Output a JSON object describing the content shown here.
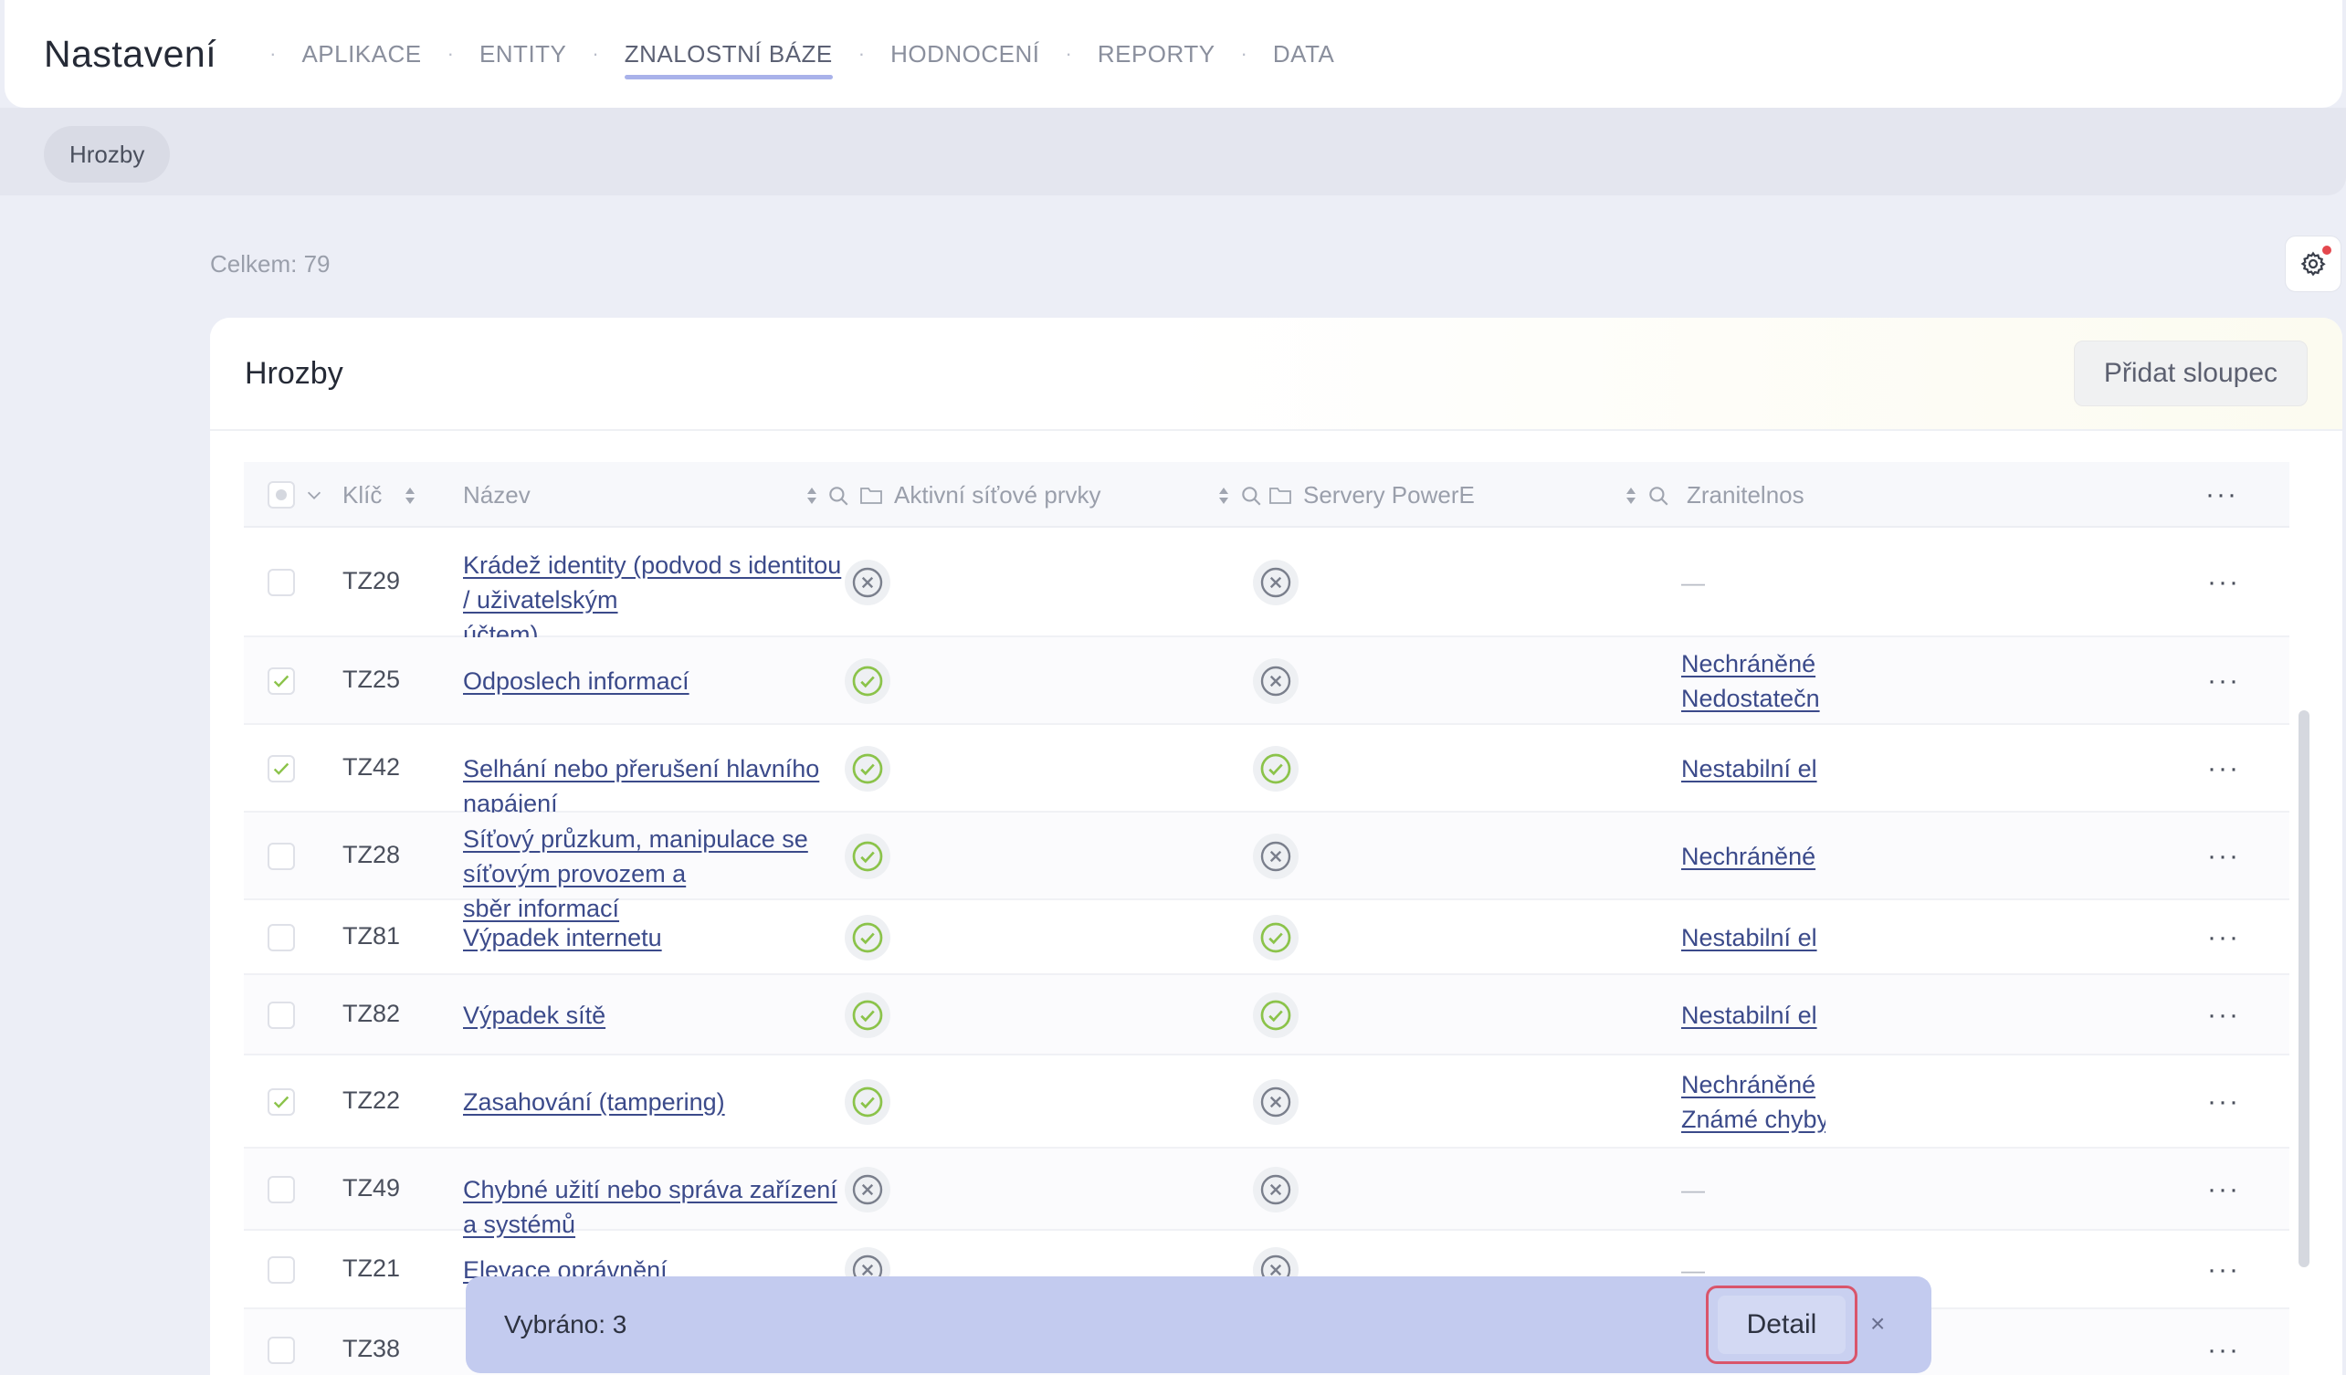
{
  "header": {
    "title": "Nastavení",
    "nav": [
      {
        "label": "APLIKACE",
        "active": false
      },
      {
        "label": "ENTITY",
        "active": false
      },
      {
        "label": "ZNALOSTNÍ BÁZE",
        "active": true
      },
      {
        "label": "HODNOCENÍ",
        "active": false
      },
      {
        "label": "REPORTY",
        "active": false
      },
      {
        "label": "DATA",
        "active": false
      }
    ]
  },
  "subnav": {
    "chip": "Hrozby"
  },
  "summary": {
    "total": "Celkem: 79"
  },
  "card": {
    "title": "Hrozby",
    "add_column_label": "Přidat sloupec"
  },
  "table": {
    "columns": {
      "key": "Klíč",
      "name": "Název",
      "col1": "Aktivní síťové prvky",
      "col2": "Servery PowerE",
      "col3": "Zranitelnos"
    },
    "rows": [
      {
        "checked": false,
        "key": "TZ29",
        "name": [
          "Krádež identity (podvod s identitou / uživatelským",
          "účtem)"
        ],
        "c1": "x",
        "c2": "x",
        "vuln": [
          "—"
        ]
      },
      {
        "checked": true,
        "key": "TZ25",
        "name": [
          "Odposlech informací"
        ],
        "c1": "ok",
        "c2": "x",
        "vuln": [
          "Nechráněné",
          "Nedostatečn"
        ]
      },
      {
        "checked": true,
        "key": "TZ42",
        "name": [
          "Selhání nebo přerušení hlavního napájení"
        ],
        "c1": "ok",
        "c2": "ok",
        "vuln": [
          "Nestabilní el"
        ]
      },
      {
        "checked": false,
        "key": "TZ28",
        "name": [
          "Síťový průzkum, manipulace se síťovým provozem a",
          "sběr informací"
        ],
        "c1": "ok",
        "c2": "x",
        "vuln": [
          "Nechráněné"
        ]
      },
      {
        "checked": false,
        "key": "TZ81",
        "name": [
          "Výpadek internetu"
        ],
        "c1": "ok",
        "c2": "ok",
        "vuln": [
          "Nestabilní el"
        ]
      },
      {
        "checked": false,
        "key": "TZ82",
        "name": [
          "Výpadek sítě"
        ],
        "c1": "ok",
        "c2": "ok",
        "vuln": [
          "Nestabilní el"
        ]
      },
      {
        "checked": true,
        "key": "TZ22",
        "name": [
          "Zasahování (tampering)"
        ],
        "c1": "ok",
        "c2": "x",
        "vuln": [
          "Nechráněné",
          "Známé chyby"
        ]
      },
      {
        "checked": false,
        "key": "TZ49",
        "name": [
          "Chybné užití nebo správa zařízení a systémů"
        ],
        "c1": "x",
        "c2": "x",
        "vuln": [
          "—"
        ]
      },
      {
        "checked": false,
        "key": "TZ21",
        "name": [
          "Elevace oprávnění"
        ],
        "c1": "x",
        "c2": "x",
        "vuln": [
          "—"
        ]
      },
      {
        "checked": false,
        "key": "TZ38",
        "name": [],
        "c1": "",
        "c2": "",
        "vuln": [
          "—"
        ]
      }
    ]
  },
  "selection_bar": {
    "text": "Vybráno: 3",
    "detail_label": "Detail",
    "close_label": "×"
  },
  "colors": {
    "accent": "#a9b2ea",
    "check_green": "#8bc34a",
    "selection_bg": "#c3cbef",
    "highlight_border": "#d9556b"
  }
}
